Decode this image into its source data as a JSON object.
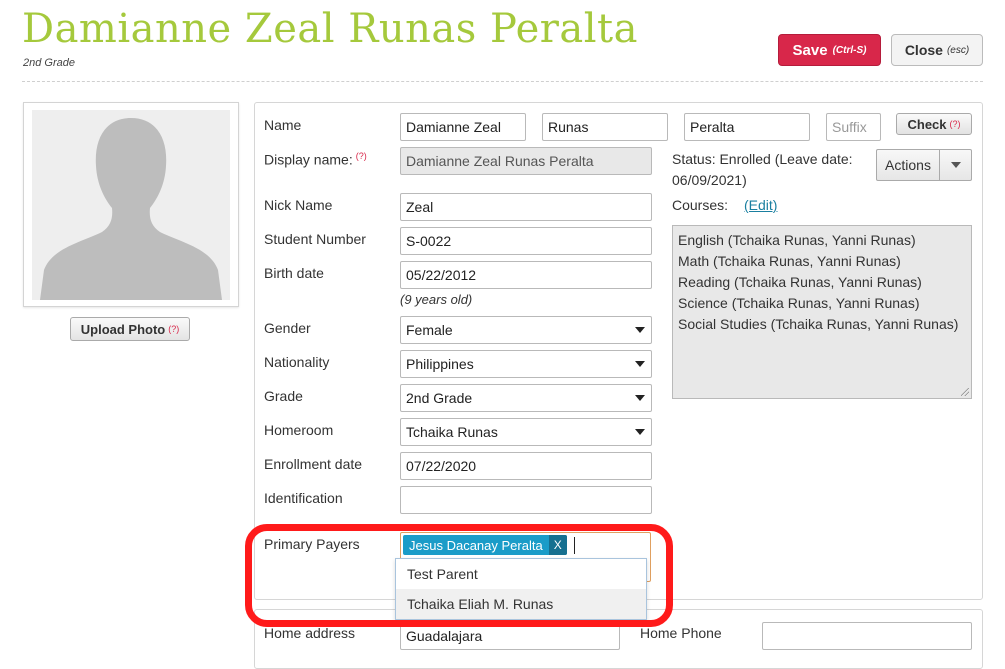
{
  "header": {
    "title": "Damianne Zeal Runas Peralta",
    "subtitle": "2nd Grade",
    "save_label": "Save",
    "save_shortcut": "(Ctrl-S)",
    "close_label": "Close",
    "close_shortcut": "(esc)"
  },
  "photo": {
    "upload_label": "Upload Photo",
    "help": "(?)"
  },
  "form": {
    "name_label": "Name",
    "first_name": "Damianne Zeal",
    "middle_name": "Runas",
    "last_name": "Peralta",
    "suffix_placeholder": "Suffix",
    "check_label": "Check",
    "check_help": "(?)",
    "display_name_label": "Display name:",
    "display_name_help": "(?)",
    "display_name": "Damianne Zeal Runas Peralta",
    "nick_name_label": "Nick Name",
    "nick_name": "Zeal",
    "student_number_label": "Student Number",
    "student_number": "S-0022",
    "birth_date_label": "Birth date",
    "birth_date": "05/22/2012",
    "age": "(9 years old)",
    "gender_label": "Gender",
    "gender": "Female",
    "nationality_label": "Nationality",
    "nationality": "Philippines",
    "grade_label": "Grade",
    "grade": "2nd Grade",
    "homeroom_label": "Homeroom",
    "homeroom": "Tchaika Runas",
    "enrollment_date_label": "Enrollment date",
    "enrollment_date": "07/22/2020",
    "identification_label": "Identification",
    "identification": "",
    "primary_payers_label": "Primary Payers",
    "primary_payer_tag": "Jesus Dacanay Peralta",
    "tag_remove": "X"
  },
  "status": {
    "line1": "Status: Enrolled (Leave date:",
    "line2": "06/09/2021)",
    "actions_label": "Actions",
    "courses_label": "Courses:",
    "courses_edit": "(Edit)",
    "courses": [
      "English (Tchaika Runas, Yanni Runas)",
      "Math (Tchaika Runas, Yanni Runas)",
      "Reading (Tchaika Runas, Yanni Runas)",
      "Science (Tchaika Runas, Yanni Runas)",
      "Social Studies (Tchaika Runas, Yanni Runas)"
    ]
  },
  "payer_dropdown": {
    "options": [
      "Test Parent",
      "Tchaika Eliah M. Runas"
    ]
  },
  "lower": {
    "home_address_label": "Home address",
    "home_address": "Guadalajara",
    "home_phone_label": "Home Phone",
    "home_phone": ""
  },
  "colors": {
    "title": "#a5c93c",
    "save": "#d8274a",
    "tag": "#1a9cc8",
    "highlight": "#ff1a1a"
  }
}
